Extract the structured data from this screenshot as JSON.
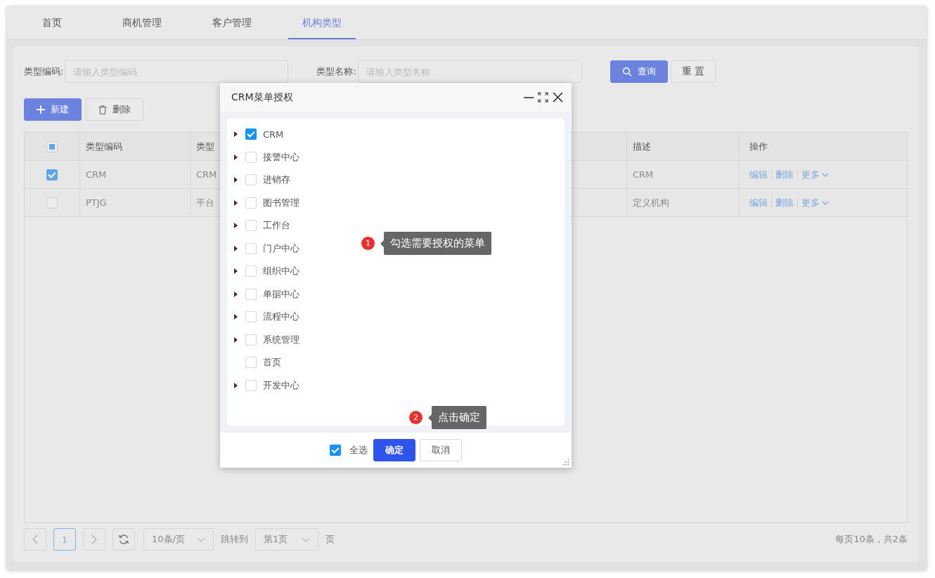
{
  "tabs": [
    {
      "label": "首页",
      "selected": false
    },
    {
      "label": "商机管理",
      "selected": false
    },
    {
      "label": "客户管理",
      "selected": false
    },
    {
      "label": "机构类型",
      "selected": true
    }
  ],
  "search": {
    "fields": [
      {
        "label": "类型编码:",
        "placeholder": "请输入类型编码"
      },
      {
        "label": "类型名称:",
        "placeholder": "请输入类型名称"
      }
    ],
    "buttons": [
      {
        "label": "查询",
        "kind": "primary"
      },
      {
        "label": "重 置",
        "kind": "default"
      }
    ]
  },
  "toolbar": [
    {
      "label": "新建",
      "kind": "primary"
    },
    {
      "label": "删除",
      "kind": "default"
    }
  ],
  "table": {
    "header_indeterminate": true,
    "columns": [
      {
        "label": "类型编码"
      },
      {
        "label": "类型"
      },
      {
        "label": "描述"
      },
      {
        "label": "操作"
      }
    ],
    "rows": [
      {
        "selected": true,
        "cells": [
          "CRM",
          "CRM",
          "CRM"
        ],
        "actions": [
          "编辑",
          "删除",
          "更多"
        ]
      },
      {
        "selected": false,
        "cells": [
          "PTJG",
          "平台",
          "定义机构"
        ],
        "actions": [
          "编辑",
          "删除",
          "更多"
        ]
      }
    ]
  },
  "pagination": {
    "page": "1",
    "page_size": "10条/页",
    "jump_label": "跳转到",
    "jump_value": "第1页",
    "page_suffix": "页",
    "summary": "每页10条，共2条"
  },
  "dialog": {
    "title": "CRM菜单授权",
    "tree": [
      {
        "label": "CRM",
        "checked": true,
        "expandable": true
      },
      {
        "label": "接警中心",
        "checked": false,
        "expandable": true
      },
      {
        "label": "进销存",
        "checked": false,
        "expandable": true
      },
      {
        "label": "图书管理",
        "checked": false,
        "expandable": true
      },
      {
        "label": "工作台",
        "checked": false,
        "expandable": true
      },
      {
        "label": "门户中心",
        "checked": false,
        "expandable": true
      },
      {
        "label": "组织中心",
        "checked": false,
        "expandable": true
      },
      {
        "label": "单据中心",
        "checked": false,
        "expandable": true
      },
      {
        "label": "流程中心",
        "checked": false,
        "expandable": true
      },
      {
        "label": "系统管理",
        "checked": false,
        "expandable": true
      },
      {
        "label": "首页",
        "checked": false,
        "expandable": false
      },
      {
        "label": "开发中心",
        "checked": false,
        "expandable": true
      }
    ],
    "select_all": {
      "label": "全选",
      "checked": true
    },
    "buttons": [
      {
        "label": "确定",
        "kind": "primary"
      },
      {
        "label": "取消",
        "kind": "default"
      }
    ]
  },
  "annotations": [
    {
      "number": "1",
      "text": "勾选需要授权的菜单"
    },
    {
      "number": "2",
      "text": "点击确定"
    }
  ]
}
